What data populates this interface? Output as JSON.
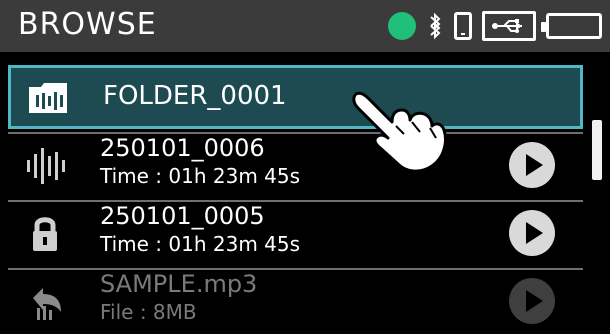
{
  "header": {
    "title": "BROWSE",
    "status": {
      "indicator_color": "#20c07a",
      "icons": [
        "bluetooth-icon",
        "phone-icon",
        "usb-icon",
        "battery-icon"
      ]
    }
  },
  "list": {
    "items": [
      {
        "name": "FOLDER_0001",
        "type": "folder",
        "selected": true,
        "icon": "folder-icon"
      },
      {
        "name": "250101_0006",
        "meta": "Time : 01h 23m 45s",
        "type": "audio",
        "icon": "waveform-icon"
      },
      {
        "name": "250101_0005",
        "meta": "Time : 01h 23m 45s",
        "type": "locked",
        "icon": "lock-icon"
      },
      {
        "name": "SAMPLE.mp3",
        "meta": "File : 8MB",
        "type": "audio",
        "icon": "return-icon",
        "dimmed": true
      }
    ]
  }
}
